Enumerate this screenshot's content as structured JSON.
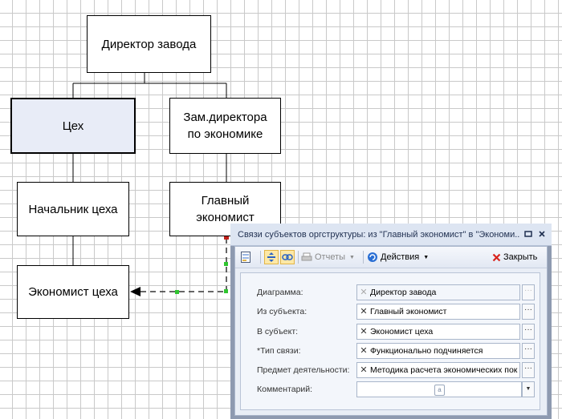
{
  "diagram": {
    "nodes": {
      "director": "Директор завода",
      "workshop": "Цех",
      "deputy": "Зам.директора\nпо экономике",
      "head": "Начальник цеха",
      "chief_economist": "Главный\nэкономист",
      "economist": "Экономист цеха"
    }
  },
  "dialog": {
    "title": "Связи субъектов оргструктуры: из \"Главный экономист\" в \"Экономи...",
    "toolbar": {
      "reports_label": "Отчеты",
      "actions_label": "Действия",
      "close_label": "Закрыть"
    },
    "fields": {
      "diagram_label": "Диаграмма:",
      "diagram_value": "Директор завода",
      "from_label": "Из субъекта:",
      "from_value": "Главный экономист",
      "to_label": "В субъект:",
      "to_value": "Экономист цеха",
      "link_type_label": "*Тип связи:",
      "link_type_value": "Функционально подчиняется",
      "activity_label": "Предмет деятельности:",
      "activity_value": "Методика расчета экономических пок",
      "comment_label": "Комментарий:",
      "comment_value": ""
    }
  }
}
